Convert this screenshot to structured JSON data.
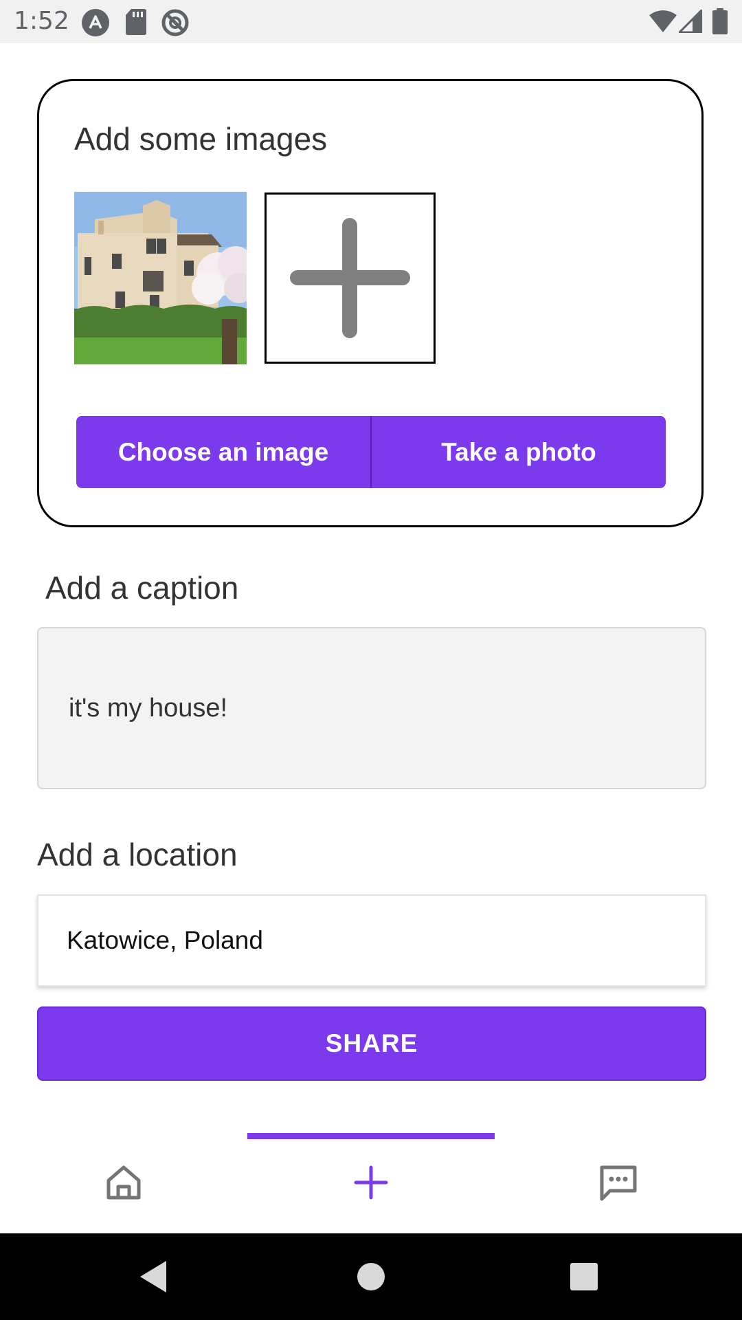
{
  "status_bar": {
    "time": "1:52",
    "left_icons": [
      "app-a-icon",
      "sd-card-icon",
      "no-sync-icon"
    ],
    "right_icons": [
      "wifi-icon",
      "signal-icon",
      "battery-icon"
    ]
  },
  "images_card": {
    "title": "Add some images",
    "thumbnail_icon": "house-photo",
    "add_icon": "plus-icon",
    "choose_label": "Choose an image",
    "photo_label": "Take a photo"
  },
  "caption": {
    "title": "Add a caption",
    "value": "it's my house!"
  },
  "location": {
    "title": "Add a location",
    "value": "Katowice, Poland"
  },
  "share_label": "SHARE",
  "bottom_tabs": [
    {
      "icon": "home-icon",
      "active": false
    },
    {
      "icon": "plus-icon",
      "active": true
    },
    {
      "icon": "chat-icon",
      "active": false
    }
  ],
  "nav_bar": [
    "back-icon",
    "home-circle-icon",
    "recents-icon"
  ],
  "colors": {
    "accent": "#7c3aed",
    "inactive_icon": "#757575",
    "status_bar": "#f1f1f1",
    "caption_bg": "#f3f3f3"
  }
}
